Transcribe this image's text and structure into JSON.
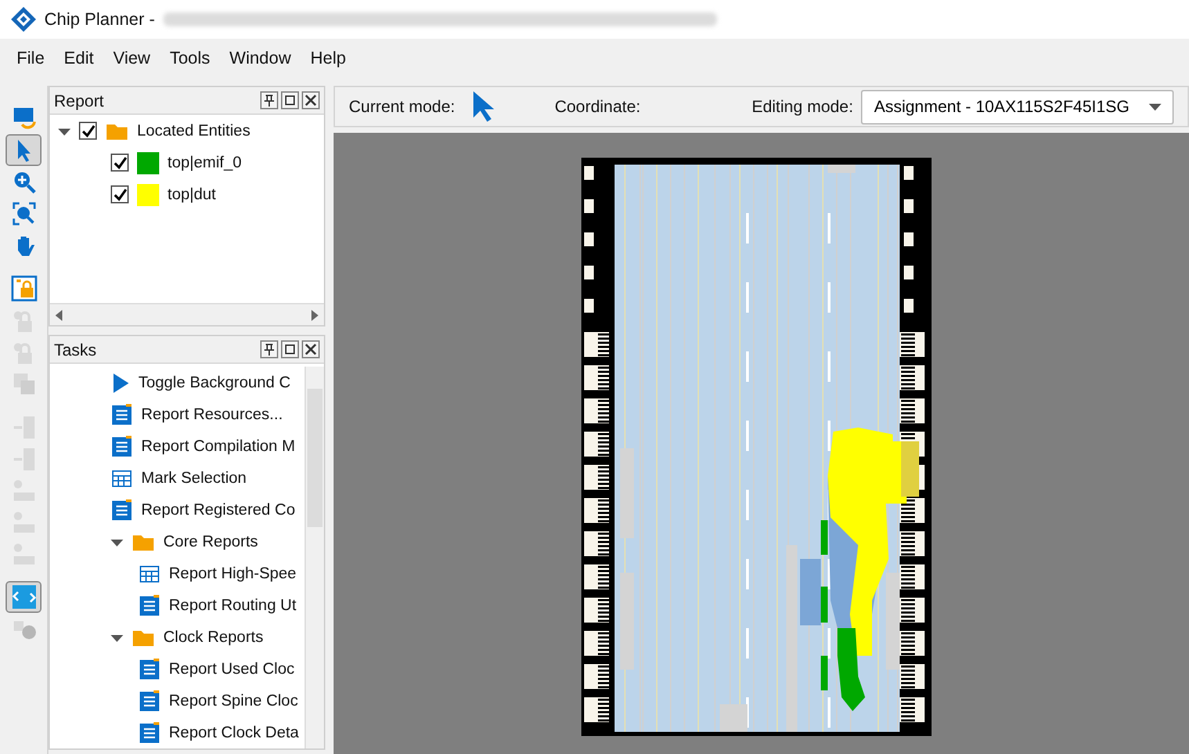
{
  "window": {
    "title": "Chip Planner -"
  },
  "menu": [
    "File",
    "Edit",
    "View",
    "Tools",
    "Window",
    "Help"
  ],
  "tools": [
    {
      "kind": "monitor",
      "selected": false,
      "disabled": false
    },
    {
      "kind": "pointer",
      "selected": true,
      "disabled": false
    },
    {
      "kind": "zoom",
      "selected": false,
      "disabled": false
    },
    {
      "kind": "zoomfit",
      "selected": false,
      "disabled": false
    },
    {
      "kind": "hand",
      "selected": false,
      "disabled": false
    },
    {
      "kind": "lockstar",
      "selected": false,
      "disabled": false
    },
    {
      "kind": "lockplus",
      "selected": false,
      "disabled": true
    },
    {
      "kind": "lockx",
      "selected": false,
      "disabled": true
    },
    {
      "kind": "layers",
      "selected": false,
      "disabled": true
    },
    {
      "kind": "arrowbox",
      "selected": false,
      "disabled": true
    },
    {
      "kind": "boxswap",
      "selected": false,
      "disabled": true
    },
    {
      "kind": "rowstar",
      "selected": false,
      "disabled": true
    },
    {
      "kind": "rowx",
      "selected": false,
      "disabled": true
    },
    {
      "kind": "rowplus",
      "selected": false,
      "disabled": true
    },
    {
      "kind": "route",
      "selected": true,
      "disabled": false
    },
    {
      "kind": "clock",
      "selected": false,
      "disabled": true
    }
  ],
  "report": {
    "title": "Report",
    "tree": [
      {
        "label": "Located Entities",
        "checked": true,
        "expanded": true,
        "children": [
          {
            "label": "top|emif_0",
            "checked": true,
            "color": "#00a800"
          },
          {
            "label": "top|dut",
            "checked": true,
            "color": "#ffff00"
          }
        ]
      }
    ]
  },
  "tasks": {
    "title": "Tasks",
    "items": [
      {
        "kind": "play",
        "label": "Toggle Background C"
      },
      {
        "kind": "report",
        "label": "Report Resources..."
      },
      {
        "kind": "report",
        "label": "Report Compilation M"
      },
      {
        "kind": "table",
        "label": "Mark Selection"
      },
      {
        "kind": "report",
        "label": "Report Registered Co"
      },
      {
        "kind": "folder",
        "label": "Core Reports",
        "expanded": true,
        "children": [
          {
            "kind": "table",
            "label": "Report High-Spee"
          },
          {
            "kind": "report",
            "label": "Report Routing Ut"
          }
        ]
      },
      {
        "kind": "folder",
        "label": "Clock Reports",
        "expanded": true,
        "children": [
          {
            "kind": "report",
            "label": "Report Used Cloc"
          },
          {
            "kind": "report",
            "label": "Report Spine Cloc"
          },
          {
            "kind": "report",
            "label": "Report Clock Deta"
          }
        ]
      }
    ]
  },
  "status": {
    "current_mode_label": "Current mode:",
    "coordinate_label": "Coordinate:",
    "editing_mode_label": "Editing mode:",
    "editing_mode": "Assignment - 10AX115S2F45I1SG"
  }
}
